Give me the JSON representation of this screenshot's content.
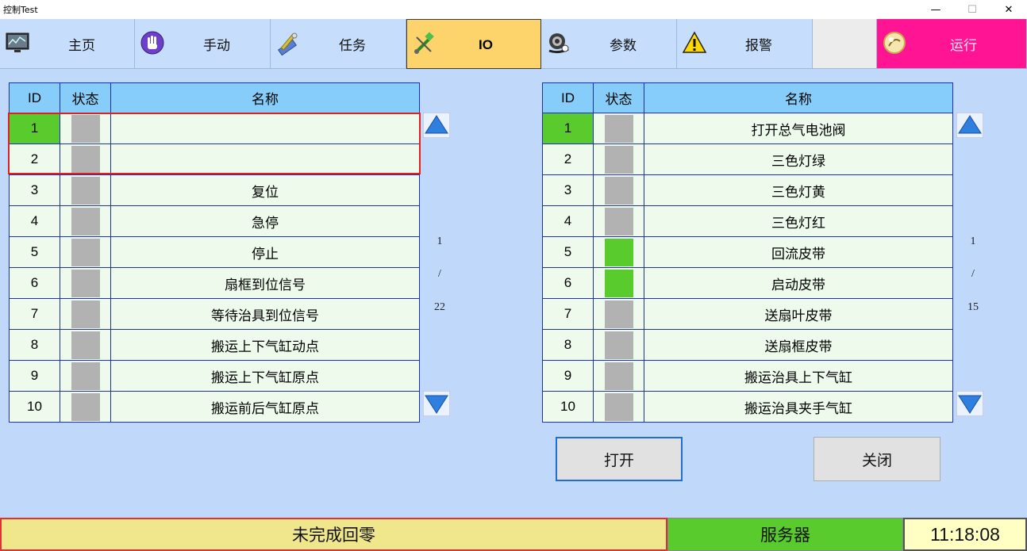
{
  "window": {
    "title": "控制Test",
    "minimize": "—",
    "maximize": "☐",
    "close": "✕"
  },
  "nav": [
    {
      "label": "主页",
      "icon": "monitor-icon"
    },
    {
      "label": "手动",
      "icon": "hand-icon"
    },
    {
      "label": "任务",
      "icon": "tools-icon"
    },
    {
      "label": "IO",
      "icon": "plug-icon",
      "active": true
    },
    {
      "label": "参数",
      "icon": "gear-icon"
    },
    {
      "label": "报警",
      "icon": "warning-icon"
    },
    {
      "label": "",
      "icon": ""
    },
    {
      "label": "运行",
      "icon": "run-icon"
    }
  ],
  "inputs_table": {
    "headers": {
      "id": "ID",
      "status": "状态",
      "name": "名称"
    },
    "rows": [
      {
        "id": "1",
        "name": "",
        "on": false,
        "selected": true
      },
      {
        "id": "2",
        "name": "",
        "on": false,
        "selected": true
      },
      {
        "id": "3",
        "name": "复位",
        "on": false
      },
      {
        "id": "4",
        "name": "急停",
        "on": false
      },
      {
        "id": "5",
        "name": "停止",
        "on": false
      },
      {
        "id": "6",
        "name": "扇框到位信号",
        "on": false
      },
      {
        "id": "7",
        "name": "等待治具到位信号",
        "on": false
      },
      {
        "id": "8",
        "name": "搬运上下气缸动点",
        "on": false
      },
      {
        "id": "9",
        "name": "搬运上下气缸原点",
        "on": false
      },
      {
        "id": "10",
        "name": "搬运前后气缸原点",
        "on": false
      }
    ],
    "pager": {
      "current": "1",
      "sep": "/",
      "total": "22"
    }
  },
  "outputs_table": {
    "headers": {
      "id": "ID",
      "status": "状态",
      "name": "名称"
    },
    "rows": [
      {
        "id": "1",
        "name": "打开总气电池阀",
        "on": false,
        "id_highlight": true
      },
      {
        "id": "2",
        "name": "三色灯绿",
        "on": false
      },
      {
        "id": "3",
        "name": "三色灯黄",
        "on": false
      },
      {
        "id": "4",
        "name": "三色灯红",
        "on": false
      },
      {
        "id": "5",
        "name": "回流皮带",
        "on": true
      },
      {
        "id": "6",
        "name": "启动皮带",
        "on": true
      },
      {
        "id": "7",
        "name": "送扇叶皮带",
        "on": false
      },
      {
        "id": "8",
        "name": "送扇框皮带",
        "on": false
      },
      {
        "id": "9",
        "name": "搬运治具上下气缸",
        "on": false
      },
      {
        "id": "10",
        "name": "搬运治具夹手气缸",
        "on": false
      }
    ],
    "pager": {
      "current": "1",
      "sep": "/",
      "total": "15"
    }
  },
  "actions": {
    "open": "打开",
    "close": "关闭"
  },
  "statusbar": {
    "homing": "未完成回零",
    "server": "服务器",
    "time": "11:18:08"
  },
  "colors": {
    "on": "#5acb2c",
    "off": "#b2b2b2",
    "header": "#87cdfa",
    "active_tab": "#fdd36b",
    "run_tab": "#ff1493"
  }
}
